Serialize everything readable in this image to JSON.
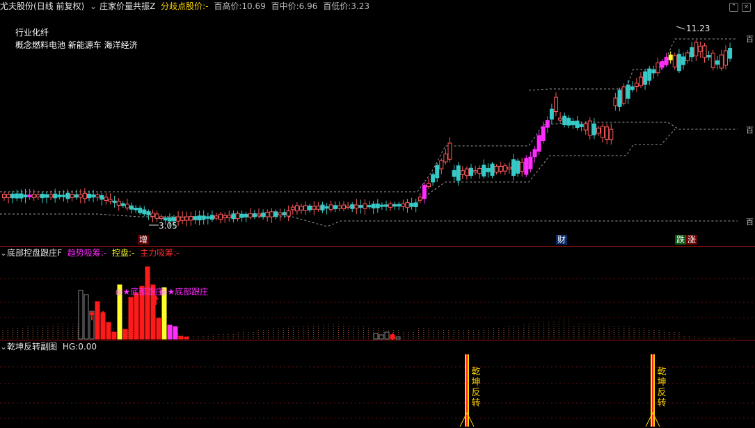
{
  "main_panel": {
    "stock_name": "尤夫股份",
    "period": "(日线 前复权)",
    "indicator_name": "庄家价量共振Z",
    "divergence_label": "分歧点股价:",
    "divergence_value": "-",
    "hundred_high_label": "百高价:",
    "hundred_high_value": "10.69",
    "hundred_mid_label": "百中价:",
    "hundred_mid_value": "6.96",
    "hundred_low_label": "百低价:",
    "hundred_low_value": "3.23",
    "industry": "行业化纤",
    "concepts": "概念燃料电池 新能源车 海洋经济",
    "high_marker": "11.23",
    "low_marker": "3.05",
    "axis_labels": [
      "百",
      "百",
      "百"
    ],
    "event_tags": [
      "增",
      "财",
      "跌",
      "涨"
    ],
    "colors": {
      "up": "#ff5a5a",
      "down": "#36c9c6",
      "magenta": "#ff2bff",
      "yellow": "#ffff2a",
      "dashed": "#9a9a9a"
    }
  },
  "sub_panel_1": {
    "title": "底部控盘跟庄F",
    "trend_label": "趋势吸筹:",
    "trend_value": "-",
    "control_label": "控盘:",
    "control_value": "-",
    "main_label": "主力吸筹:",
    "main_value": "-",
    "annotation_1": "底部跟庄",
    "annotation_2": "底部跟庄"
  },
  "sub_panel_2": {
    "title": "乾坤反转副图",
    "hg_label": "HG:",
    "hg_value": "0.00",
    "signal_1": [
      "乾",
      "坤",
      "反",
      "转"
    ],
    "signal_2": [
      "乾",
      "坤",
      "反",
      "转"
    ]
  },
  "chart_data": {
    "type": "candlestick",
    "title": "尤夫股份",
    "hundred_high": 10.69,
    "hundred_mid": 6.96,
    "hundred_low": 3.23,
    "max_marker": 11.23,
    "min_marker": 3.05
  }
}
